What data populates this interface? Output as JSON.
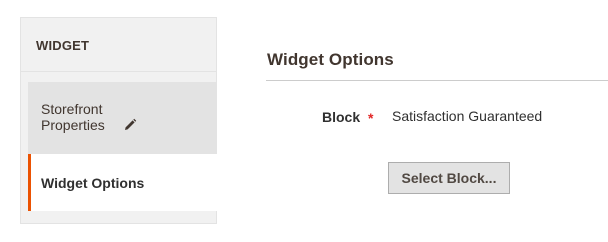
{
  "sidebar": {
    "header": "WIDGET",
    "tabs": [
      {
        "label_line1": "Storefront",
        "label_line2": "Properties",
        "icon": "pencil-icon",
        "active": false
      },
      {
        "label": "Widget Options",
        "active": true
      }
    ]
  },
  "main": {
    "title": "Widget Options",
    "field": {
      "label": "Block",
      "required_marker": "*",
      "value": "Satisfaction Guaranteed"
    },
    "select_button_label": "Select Block..."
  },
  "colors": {
    "accent": "#eb5202",
    "required": "#e22626",
    "sidebar_bg": "#f1f1f1",
    "inactive_tab_bg": "#e3e3e3"
  }
}
